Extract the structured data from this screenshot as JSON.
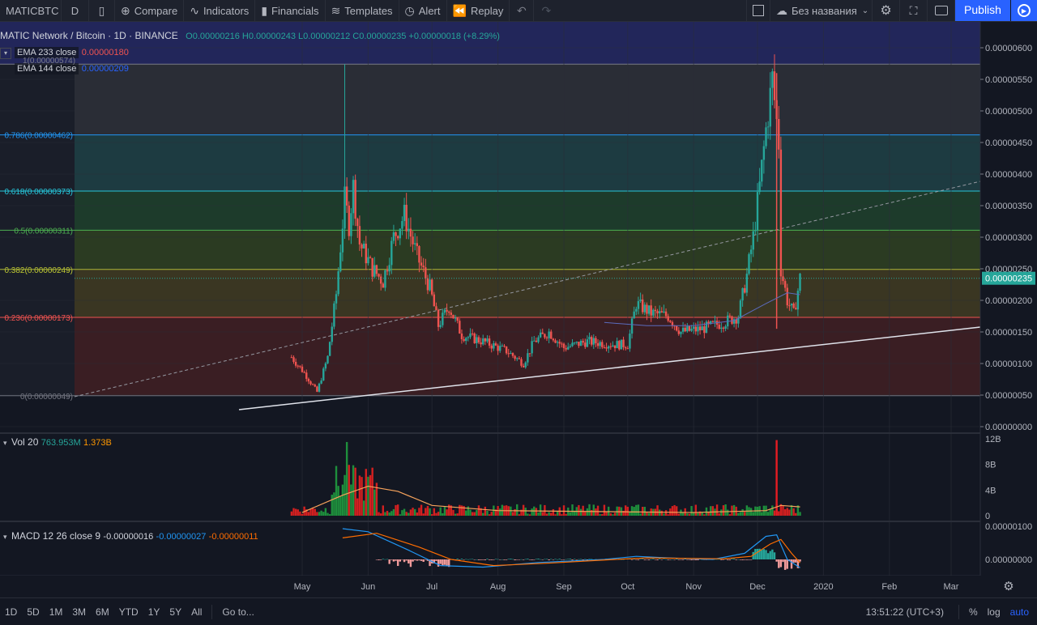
{
  "topbar": {
    "symbol": "MATICBTC",
    "interval": "D",
    "compare": "Compare",
    "indicators": "Indicators",
    "financials": "Financials",
    "templates": "Templates",
    "alert": "Alert",
    "replay": "Replay",
    "layout_name": "Без названия",
    "publish": "Publish"
  },
  "legend": {
    "title": "MATIC Network / Bitcoin · 1D · BINANCE",
    "ohlc": "O0.00000216 H0.00000243 L0.00000212 C0.00000235 +0.00000018 (+8.29%)",
    "ema233_label": "EMA 233 close",
    "ema233_value": "0.00000180",
    "ema144_label": "EMA 144 close",
    "ema144_value": "0.00000209",
    "vol_label": "Vol 20",
    "vol_v1": "763.953M",
    "vol_v2": "1.373B",
    "macd_label": "MACD 12 26 close 9",
    "macd_v1": "-0.00000016",
    "macd_v2": "-0.00000027",
    "macd_v3": "-0.00000011",
    "fib_top_partial": "1(0.00000574)"
  },
  "colors": {
    "up": "#26a69a",
    "down": "#ef5350",
    "background": "#131722",
    "grid": "#1f2430",
    "accent": "#2962ff",
    "ma": "#f7a35c",
    "macd_line": "#2196f3",
    "signal_line": "#ff6d00"
  },
  "chart_data": {
    "type": "candlestick",
    "title": "MATIC Network / Bitcoin · 1D · BINANCE",
    "x_ticks": [
      "May",
      "Jun",
      "Jul",
      "Aug",
      "Sep",
      "Oct",
      "Nov",
      "Dec",
      "2020",
      "Feb",
      "Mar"
    ],
    "y_ticks": [
      "0.00000600",
      "0.00000550",
      "0.00000500",
      "0.00000450",
      "0.00000400",
      "0.00000350",
      "0.00000300",
      "0.00000250",
      "0.00000200",
      "0.00000150",
      "0.00000100",
      "0.00000050",
      "0.00000000"
    ],
    "ylim": [
      0,
      6.2e-06
    ],
    "last_price": "0.00000235",
    "fib_levels": [
      {
        "label": "0.786(0.00000462)",
        "price": 4.62e-06
      },
      {
        "label": "0.618(0.00000373)",
        "price": 3.73e-06
      },
      {
        "label": "0.5(0.00000311)",
        "price": 3.11e-06
      },
      {
        "label": "0.382(0.00000249)",
        "price": 2.49e-06
      },
      {
        "label": "0.236(0.00000173)",
        "price": 1.73e-06
      },
      {
        "label": "0(0.00000049)",
        "price": 4.9e-07
      }
    ],
    "fib_top_price": 5.74e-06,
    "close_series": [
      {
        "date": "2019-04-26",
        "close": 1.1e-06
      },
      {
        "date": "2019-05-02",
        "close": 8.5e-07
      },
      {
        "date": "2019-05-08",
        "close": 5.5e-07
      },
      {
        "date": "2019-05-13",
        "close": 1.1e-06
      },
      {
        "date": "2019-05-17",
        "close": 2.1e-06
      },
      {
        "date": "2019-05-21",
        "close": 3.6e-06
      },
      {
        "date": "2019-05-23",
        "close": 3.2e-06
      },
      {
        "date": "2019-05-25",
        "close": 3.8e-06
      },
      {
        "date": "2019-05-28",
        "close": 2.9e-06
      },
      {
        "date": "2019-06-03",
        "close": 2.5e-06
      },
      {
        "date": "2019-06-08",
        "close": 2.3e-06
      },
      {
        "date": "2019-06-13",
        "close": 3e-06
      },
      {
        "date": "2019-06-18",
        "close": 3.35e-06
      },
      {
        "date": "2019-06-24",
        "close": 2.7e-06
      },
      {
        "date": "2019-06-30",
        "close": 2.2e-06
      },
      {
        "date": "2019-07-04",
        "close": 1.6e-06
      },
      {
        "date": "2019-07-09",
        "close": 1.9e-06
      },
      {
        "date": "2019-07-15",
        "close": 1.45e-06
      },
      {
        "date": "2019-07-25",
        "close": 1.35e-06
      },
      {
        "date": "2019-08-05",
        "close": 1.2e-06
      },
      {
        "date": "2019-08-13",
        "close": 1e-06
      },
      {
        "date": "2019-08-18",
        "close": 1.35e-06
      },
      {
        "date": "2019-08-25",
        "close": 1.5e-06
      },
      {
        "date": "2019-09-01",
        "close": 1.25e-06
      },
      {
        "date": "2019-09-12",
        "close": 1.35e-06
      },
      {
        "date": "2019-09-25",
        "close": 1.3e-06
      },
      {
        "date": "2019-10-01",
        "close": 1.3e-06
      },
      {
        "date": "2019-10-05",
        "close": 1.95e-06
      },
      {
        "date": "2019-10-12",
        "close": 1.8e-06
      },
      {
        "date": "2019-10-20",
        "close": 1.75e-06
      },
      {
        "date": "2019-10-26",
        "close": 1.5e-06
      },
      {
        "date": "2019-11-05",
        "close": 1.55e-06
      },
      {
        "date": "2019-11-15",
        "close": 1.65e-06
      },
      {
        "date": "2019-11-22",
        "close": 1.75e-06
      },
      {
        "date": "2019-11-26",
        "close": 2.4e-06
      },
      {
        "date": "2019-11-29",
        "close": 3e-06
      },
      {
        "date": "2019-12-02",
        "close": 3.8e-06
      },
      {
        "date": "2019-12-05",
        "close": 4.7e-06
      },
      {
        "date": "2019-12-08",
        "close": 5.5e-06
      },
      {
        "date": "2019-12-11",
        "close": 4.5e-06
      },
      {
        "date": "2019-12-12",
        "close": 2.5e-06
      },
      {
        "date": "2019-12-15",
        "close": 2e-06
      },
      {
        "date": "2019-12-18",
        "close": 1.78e-06
      },
      {
        "date": "2019-12-21",
        "close": 2.35e-06
      }
    ],
    "volume_axis": [
      "12B",
      "8B",
      "4B",
      "0"
    ],
    "macd_axis": [
      "0.00000100",
      "0.00000000"
    ],
    "volume_spikes": [
      {
        "date": "2019-05-22",
        "value": 11.5
      },
      {
        "date": "2019-12-10",
        "value": 11.8
      }
    ]
  },
  "bottombar": {
    "ranges": [
      "1D",
      "5D",
      "1M",
      "3M",
      "6M",
      "YTD",
      "1Y",
      "5Y",
      "All"
    ],
    "goto": "Go to...",
    "time": "13:51:22 (UTC+3)",
    "percent": "%",
    "log": "log",
    "auto": "auto"
  }
}
